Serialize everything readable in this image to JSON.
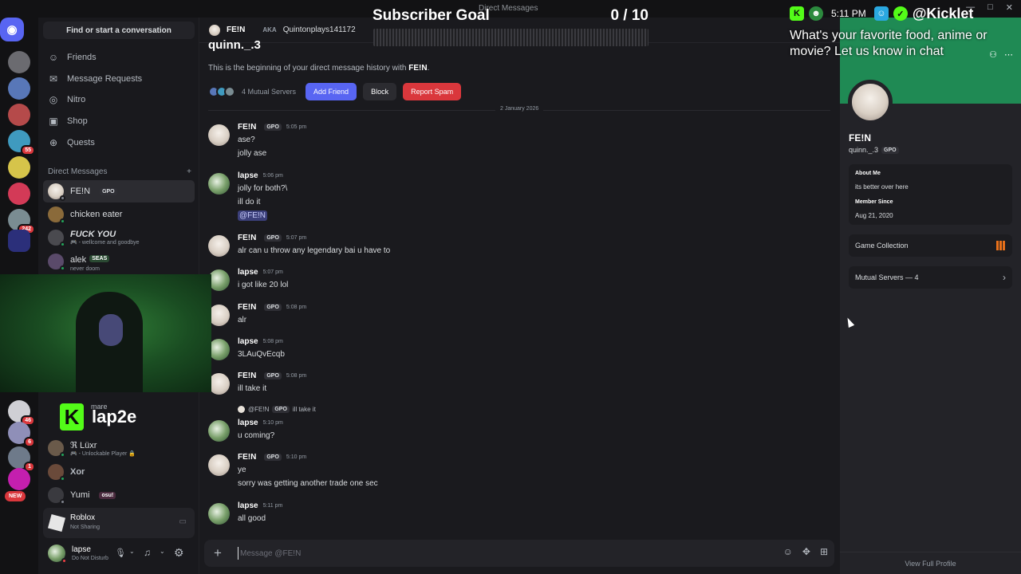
{
  "window": {
    "title": "Direct Messages",
    "controls": [
      "—",
      "□",
      "✕"
    ]
  },
  "sidebar": {
    "search": "Find or start a conversation",
    "nav": [
      {
        "label": "Friends",
        "icon": "friends-icon"
      },
      {
        "label": "Message Requests",
        "icon": "mail-icon"
      },
      {
        "label": "Nitro",
        "icon": "nitro-icon"
      },
      {
        "label": "Shop",
        "icon": "shop-icon"
      },
      {
        "label": "Quests",
        "icon": "quests-icon"
      }
    ],
    "dm_header": "Direct Messages",
    "dms": [
      {
        "name": "FE!N",
        "tag": "GPO",
        "sub": ""
      },
      {
        "name": "chicken eater",
        "tag": "",
        "sub": ""
      },
      {
        "name": "FUCK YOU",
        "tag": "",
        "sub": "🎮 - wellcome and goodbye"
      },
      {
        "name": "alek",
        "tag": "SEAS",
        "sub": "never doom"
      },
      {
        "name": "mare",
        "tag": "",
        "sub": ""
      },
      {
        "name": "ℜ Lüxr",
        "tag": "",
        "sub": "🎮 - Unlockable Player 🔒"
      },
      {
        "name": "Xor",
        "tag": "",
        "sub": ""
      },
      {
        "name": "Yumi",
        "tag": "osu!",
        "sub": ""
      }
    ],
    "server_badges": [
      "55",
      "242",
      "46",
      "6",
      "1"
    ],
    "new_badge": "NEW",
    "activity": {
      "title": "Roblox",
      "sub": "Not Sharing"
    },
    "user": {
      "name": "lapse",
      "status": "Do Not Disturb"
    }
  },
  "stream": {
    "kick_name": "lap2e",
    "sub_goal_label": "Subscriber Goal",
    "sub_goal_count": "0 / 10",
    "sub_goal_progress": 0,
    "clock": "5:11 PM",
    "handle": "@Kicklet",
    "question": "What's your favorite food, anime or movie? Let us know in chat"
  },
  "chat": {
    "header_name": "FE!N",
    "aka_label": "AKA",
    "aka_handle": "Quintonplays141172",
    "intro_name": "quinn._.3",
    "intro_prefix": "This is the beginning of your direct message history with ",
    "intro_name_bold": "FE!N",
    "intro_suffix": ".",
    "mutual": "4 Mutual Servers",
    "add_friend": "Add Friend",
    "block": "Block",
    "report": "Report Spam",
    "date": "2 January 2026",
    "composer_placeholder": "Message @FE!N",
    "messages": [
      {
        "author": "FE!N",
        "tag": "GPO",
        "time": "5:05 pm",
        "lines": [
          "ase?",
          "jolly ase"
        ]
      },
      {
        "author": "lapse",
        "tag": "",
        "time": "5:06 pm",
        "lines": [
          "jolly for both?\\",
          "ill do it"
        ],
        "mention": "@FE!N"
      },
      {
        "author": "FE!N",
        "tag": "GPO",
        "time": "5:07 pm",
        "lines": [
          "alr can u throw any legendary bai u have to"
        ]
      },
      {
        "author": "lapse",
        "tag": "",
        "time": "5:07 pm",
        "lines": [
          "i got like 20 lol"
        ]
      },
      {
        "author": "FE!N",
        "tag": "GPO",
        "time": "5:08 pm",
        "lines": [
          "alr"
        ]
      },
      {
        "author": "lapse",
        "tag": "",
        "time": "5:08 pm",
        "lines": [
          "3LAuQvEcqb"
        ]
      },
      {
        "author": "FE!N",
        "tag": "GPO",
        "time": "5:08 pm",
        "lines": [
          "ill take it"
        ]
      },
      {
        "author": "lapse",
        "tag": "",
        "time": "5:10 pm",
        "lines": [
          "u coming?"
        ],
        "reply_author": "@FE!N",
        "reply_tag": "GPO",
        "reply_text": "ill take it"
      },
      {
        "author": "FE!N",
        "tag": "GPO",
        "time": "5:10 pm",
        "lines": [
          "ye",
          "sorry was getting another trade one sec"
        ]
      },
      {
        "author": "lapse",
        "tag": "",
        "time": "5:11 pm",
        "lines": [
          "all good"
        ]
      }
    ]
  },
  "profile": {
    "name": "FE!N",
    "username": "quinn._.3",
    "tag": "GPO",
    "about_label": "About Me",
    "about": "its better over here",
    "member_label": "Member Since",
    "member_since": "Aug 21, 2020",
    "game_collection": "Game Collection",
    "mutual_servers": "Mutual Servers — 4",
    "view_full": "View Full Profile"
  },
  "colors": {
    "accent": "#5865f2",
    "danger": "#da373c",
    "kick_green": "#53fc18",
    "banner": "#1f8a54"
  }
}
